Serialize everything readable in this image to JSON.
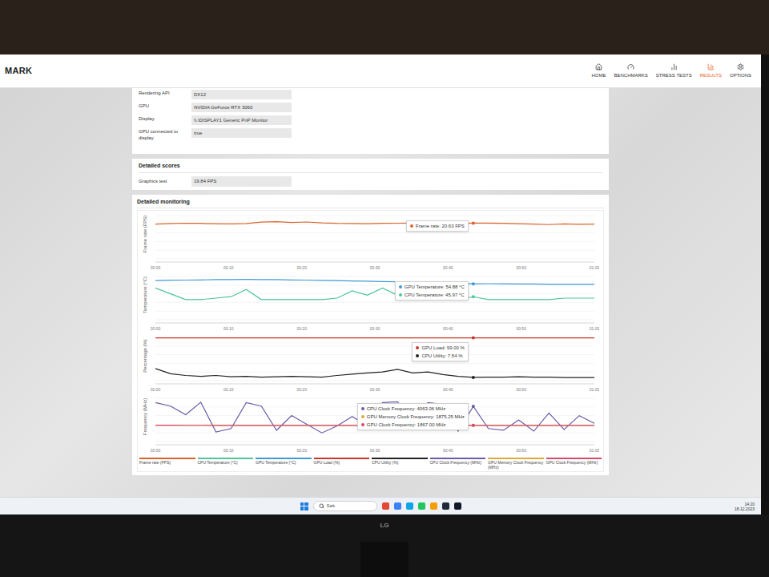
{
  "app": {
    "logo": "MARK"
  },
  "nav": [
    {
      "label": "HOME",
      "selected": false
    },
    {
      "label": "BENCHMARKS",
      "selected": false
    },
    {
      "label": "STRESS TESTS",
      "selected": false
    },
    {
      "label": "RESULTS",
      "selected": true
    },
    {
      "label": "OPTIONS",
      "selected": false
    }
  ],
  "system_info": [
    {
      "label": "Rendering API",
      "value": "DX12"
    },
    {
      "label": "GPU",
      "value": "NVIDIA GeForce RTX 3060"
    },
    {
      "label": "Display",
      "value": "\\\\.\\DISPLAY1 Generic PnP Monitor"
    },
    {
      "label": "GPU connected to display",
      "value": "true"
    }
  ],
  "detailed_scores": {
    "title": "Detailed scores",
    "rows": [
      {
        "label": "Graphics test",
        "value": "19.84 FPS"
      }
    ]
  },
  "monitoring": {
    "title": "Detailed monitoring",
    "x_ticks": [
      "00:00",
      "00:10",
      "00:20",
      "00:30",
      "00:40",
      "00:50",
      "01:00"
    ],
    "charts": [
      {
        "axis_label": "Frame rate (FPS)",
        "min": 0,
        "max": 25,
        "highlight_index": 21,
        "series": [
          {
            "name": "Frame rate",
            "color": "#d9642b",
            "values": [
              20.1,
              20.4,
              20.6,
              20.5,
              20.3,
              20.2,
              20.4,
              21.2,
              21.5,
              21.0,
              21.3,
              20.8,
              20.5,
              20.4,
              20.3,
              20.5,
              20.6,
              20.7,
              20.5,
              20.6,
              20.4,
              20.63,
              20.7,
              20.5,
              20.3,
              20.1,
              19.8,
              20.2,
              20.0,
              20.1
            ]
          }
        ],
        "tooltip": [
          {
            "text": "Frame rate: 20.63 FPS",
            "color": "#d9642b"
          }
        ]
      },
      {
        "axis_label": "Temperature (°C)",
        "min": 30,
        "max": 60,
        "highlight_index": 21,
        "series": [
          {
            "name": "GPU Temperature",
            "color": "#3f9ad6",
            "values": [
              57.2,
              57.4,
              57.5,
              57.6,
              57.8,
              57.9,
              58.0,
              57.9,
              57.8,
              57.6,
              57.5,
              57.3,
              57.1,
              56.9,
              56.7,
              56.5,
              56.3,
              56.1,
              55.9,
              55.7,
              55.5,
              54.88,
              55.0,
              54.9,
              54.8,
              54.8,
              54.7,
              54.7,
              54.6,
              54.6
            ]
          },
          {
            "name": "CPU Temperature",
            "color": "#4ec59a",
            "values": [
              52,
              48,
              44,
              44,
              45,
              46,
              51,
              44,
              44,
              44,
              44,
              44,
              45,
              50,
              47,
              52,
              47,
              45,
              44,
              44,
              44,
              45.97,
              44,
              44,
              44,
              44,
              44,
              45,
              45,
              45
            ]
          }
        ],
        "tooltip": [
          {
            "text": "GPU Temperature: 54.88 °C",
            "color": "#3f9ad6"
          },
          {
            "text": "CPU Temperature: 45.97 °C",
            "color": "#4ec59a"
          }
        ]
      },
      {
        "axis_label": "Percentage (%)",
        "min": 0,
        "max": 100,
        "highlight_index": 21,
        "series": [
          {
            "name": "GPU Load",
            "color": "#c8372d",
            "values": [
              99,
              99,
              99,
              99,
              99,
              99,
              99,
              99,
              99,
              99,
              99,
              99,
              99,
              99,
              99,
              99,
              99,
              99,
              99,
              99,
              99,
              99,
              99,
              99,
              99,
              99,
              99,
              99,
              99,
              99
            ]
          },
          {
            "name": "CPU Utility",
            "color": "#222222",
            "values": [
              28,
              16,
              12,
              10,
              12,
              9,
              10,
              8,
              9,
              10,
              9,
              8,
              12,
              15,
              18,
              20,
              26,
              18,
              20,
              14,
              10,
              7.54,
              8,
              8,
              9,
              8,
              8,
              7,
              7,
              7
            ]
          }
        ],
        "tooltip": [
          {
            "text": "GPU Load: 99.00 %",
            "color": "#c8372d"
          },
          {
            "text": "CPU Utility: 7.54 %",
            "color": "#222222"
          }
        ]
      },
      {
        "axis_label": "Frequency (MHz)",
        "min": 0,
        "max": 5000,
        "highlight_index": 21,
        "series": [
          {
            "name": "CPU Clock Frequency",
            "color": "#6b5ba8",
            "values": [
              4500,
              4100,
              3100,
              4550,
              1100,
              1500,
              4500,
              4100,
              1300,
              3000,
              2000,
              1000,
              1800,
              2900,
              1800,
              4500,
              4600,
              2000,
              4500,
              4300,
              1200,
              4063.06,
              1500,
              1300,
              2500,
              1200,
              3300,
              1400,
              3000,
              2100
            ]
          },
          {
            "name": "GPU Memory Clock Frequency",
            "color": "#e0a93a",
            "values": [
              1875.25,
              1875.25,
              1875.25,
              1875.25,
              1875.25,
              1875.25,
              1875.25,
              1875.25,
              1875.25,
              1875.25,
              1875.25,
              1875.25,
              1875.25,
              1875.25,
              1875.25,
              1875.25,
              1875.25,
              1875.25,
              1875.25,
              1875.25,
              1875.25,
              1875.25,
              1875.25,
              1875.25,
              1875.25,
              1875.25,
              1875.25,
              1875.25,
              1875.25,
              1875.25
            ]
          },
          {
            "name": "GPU Clock Frequency",
            "color": "#d6496a",
            "values": [
              1890,
              1882,
              1875,
              1875,
              1870,
              1870,
              1867,
              1867,
              1867,
              1867,
              1867,
              1867,
              1867,
              1867,
              1867,
              1867,
              1867,
              1867,
              1867,
              1867,
              1867,
              1867,
              1867,
              1867,
              1867,
              1867,
              1867,
              1867,
              1867,
              1867
            ]
          }
        ],
        "tooltip": [
          {
            "text": "CPU Clock Frequency: 4063.06 MHz",
            "color": "#6b5ba8"
          },
          {
            "text": "GPU Memory Clock Frequency: 1875.25 MHz",
            "color": "#e0a93a"
          },
          {
            "text": "GPU Clock Frequency: 1867.00 MHz",
            "color": "#d6496a"
          }
        ]
      }
    ],
    "legend": [
      {
        "label": "Frame rate (FPS)",
        "color": "#d9642b"
      },
      {
        "label": "CPU Temperature (°C)",
        "color": "#4ec59a"
      },
      {
        "label": "GPU Temperature (°C)",
        "color": "#3f9ad6"
      },
      {
        "label": "GPU Load (%)",
        "color": "#c8372d"
      },
      {
        "label": "CPU Utility (%)",
        "color": "#222222"
      },
      {
        "label": "CPU Clock Frequency (MHz)",
        "color": "#6b5ba8"
      },
      {
        "label": "GPU Memory Clock Frequency (MHz)",
        "color": "#e0a93a"
      },
      {
        "label": "GPU Clock Frequency (MHz)",
        "color": "#d6496a"
      }
    ]
  },
  "taskbar": {
    "search_placeholder": "Søk",
    "apps": [
      {
        "color": "#e24a33"
      },
      {
        "color": "#3b82f6"
      },
      {
        "color": "#0ea5e9"
      },
      {
        "color": "#22c55e"
      },
      {
        "color": "#f59e0b"
      },
      {
        "color": "#1f2937"
      },
      {
        "color": "#111827"
      }
    ],
    "time": "14:20",
    "date": "18.12.2023"
  },
  "monitor_brand": "LG"
}
